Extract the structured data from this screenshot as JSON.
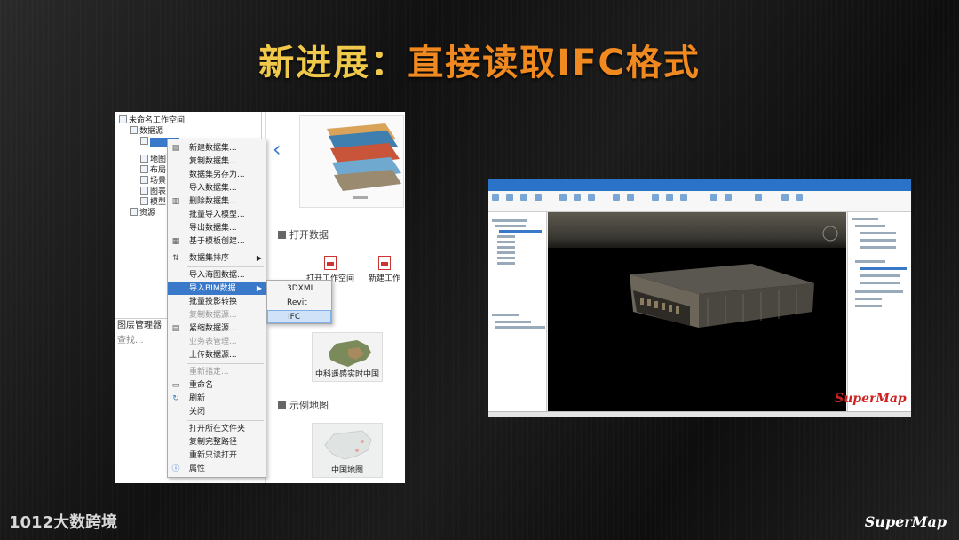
{
  "slide": {
    "title_prefix": "新进展：",
    "title_main": "直接读取IFC格式"
  },
  "left_panel": {
    "tree": [
      "未命名工作空间",
      "数据源",
      "地图",
      "布局",
      "场景",
      "图表",
      "模型",
      "资源"
    ],
    "layer_manager_title": "图层管理器",
    "layer_search_placeholder": "查找...",
    "open_data_label": "打开数据",
    "open_workspace_label": "打开工作空间",
    "new_workspace_label": "新建工作",
    "map_china_label": "中科遥感实时中国",
    "sample_maps_label": "示例地图",
    "china_map_label": "中国地图",
    "context_menu": [
      {
        "label": "新建数据集...",
        "disabled": false,
        "icon": "db-icon"
      },
      {
        "label": "复制数据集...",
        "disabled": false
      },
      {
        "label": "数据集另存为...",
        "disabled": false
      },
      {
        "label": "导入数据集...",
        "disabled": false
      },
      {
        "label": "删除数据集...",
        "disabled": false,
        "icon": "delete-icon"
      },
      {
        "label": "批量导入模型...",
        "disabled": false
      },
      {
        "label": "导出数据集...",
        "disabled": false
      },
      {
        "label": "基于模板创建...",
        "disabled": false,
        "icon": "template-icon"
      },
      {
        "label": "数据集排序",
        "disabled": false,
        "icon": "sort-icon",
        "submenu": true
      },
      {
        "label": "导入海图数据...",
        "disabled": false
      },
      {
        "label": "导入BIM数据",
        "disabled": false,
        "submenu": true,
        "active": true
      },
      {
        "label": "批量投影转换",
        "disabled": false
      },
      {
        "label": "复制数据源...",
        "disabled": true
      },
      {
        "label": "紧缩数据源...",
        "disabled": false,
        "icon": "compact-icon"
      },
      {
        "label": "业务表管理...",
        "disabled": true
      },
      {
        "label": "上传数据源...",
        "disabled": false
      },
      {
        "label": "重新指定...",
        "disabled": true
      },
      {
        "label": "重命名",
        "disabled": false,
        "icon": "rename-icon"
      },
      {
        "label": "刷新",
        "disabled": false,
        "icon": "refresh-icon"
      },
      {
        "label": "关闭",
        "disabled": false
      },
      {
        "label": "打开所在文件夹",
        "disabled": false
      },
      {
        "label": "复制完整路径",
        "disabled": false
      },
      {
        "label": "重新只读打开",
        "disabled": false
      },
      {
        "label": "属性",
        "disabled": false,
        "icon": "info-icon"
      }
    ],
    "submenu": [
      {
        "label": "3DXML",
        "active": false
      },
      {
        "label": "Revit",
        "active": false
      },
      {
        "label": "IFC",
        "active": true
      }
    ]
  },
  "right_panel": {
    "logo": "SuperMap"
  },
  "footer": {
    "left_brand": "1012大数跨境",
    "right_brand": "SuperMap"
  },
  "colors": {
    "title_yellow": "#f0c84a",
    "title_orange": "#f08a20",
    "highlight_blue": "#3a79c9"
  }
}
